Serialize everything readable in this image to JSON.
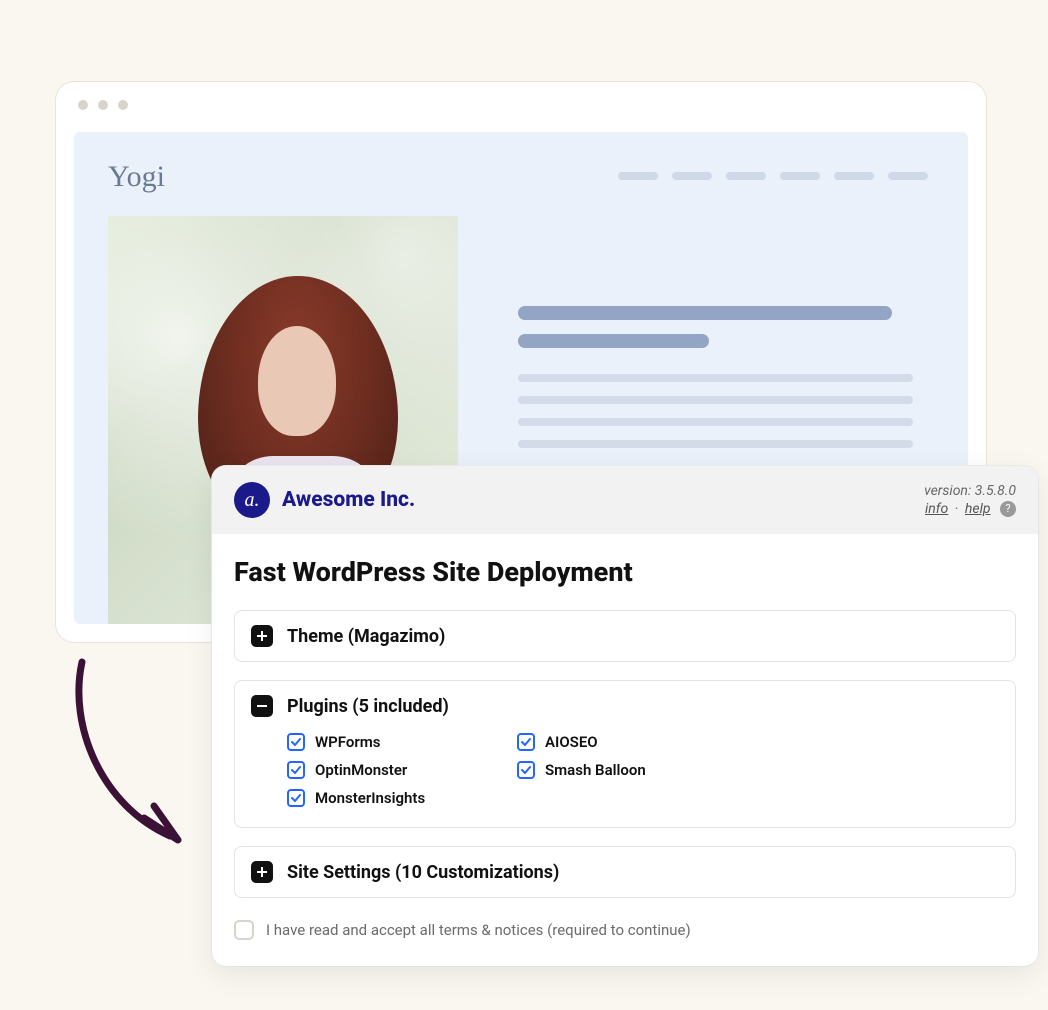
{
  "site": {
    "title": "Yogi"
  },
  "panel": {
    "brand": "Awesome Inc.",
    "logo_glyph": "a.",
    "version_label": "version: 3.5.8.0",
    "info_label": "info",
    "help_label": "help",
    "separator": "·",
    "title": "Fast WordPress Site Deployment"
  },
  "sections": {
    "theme": "Theme (Magazimo)",
    "plugins": "Plugins (5 included)",
    "settings": "Site Settings (10 Customizations)"
  },
  "plugins": {
    "p0": "WPForms",
    "p1": "AIOSEO",
    "p2": "OptinMonster",
    "p3": "Smash Balloon",
    "p4": "MonsterInsights"
  },
  "terms": {
    "label": "I have read and accept all terms & notices (required to continue)"
  }
}
